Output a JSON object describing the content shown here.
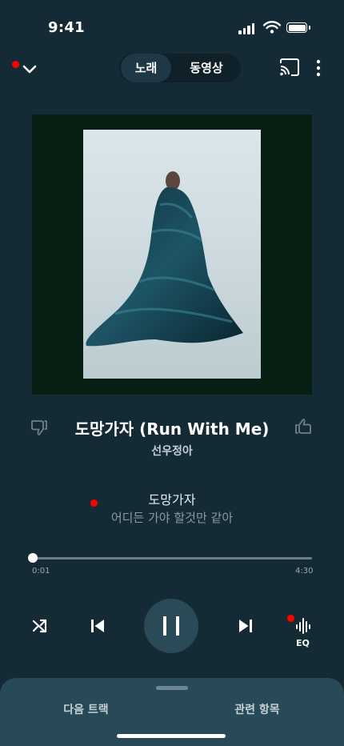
{
  "status_bar": {
    "time": "9:41"
  },
  "header": {
    "toggle": {
      "song_label": "노래",
      "video_label": "동영상",
      "selected": "노래"
    }
  },
  "track": {
    "title": "도망가자 (Run With Me)",
    "artist": "선우정아"
  },
  "lyrics": {
    "current": "도망가자",
    "next": "어디든 가야 할것만 같아"
  },
  "progress": {
    "elapsed": "0:01",
    "total": "4:30",
    "fraction": 0.004
  },
  "controls": {
    "eq_label": "EQ",
    "state": "playing"
  },
  "bottom_sheet": {
    "tabs": [
      {
        "label": "다음 트랙"
      },
      {
        "label": "관련 항목"
      }
    ]
  },
  "icons": [
    "chevron-down-icon",
    "cast-icon",
    "more-vert-icon",
    "thumb-down-icon",
    "thumb-up-icon",
    "shuffle-icon",
    "previous-icon",
    "pause-icon",
    "next-icon",
    "equalizer-icon"
  ],
  "colors": {
    "background": "#142a35",
    "bottom_sheet": "#274958",
    "play_button": "#2a4a57",
    "notification_dot": "#ff0000",
    "artwork_frame": "#071f12"
  }
}
